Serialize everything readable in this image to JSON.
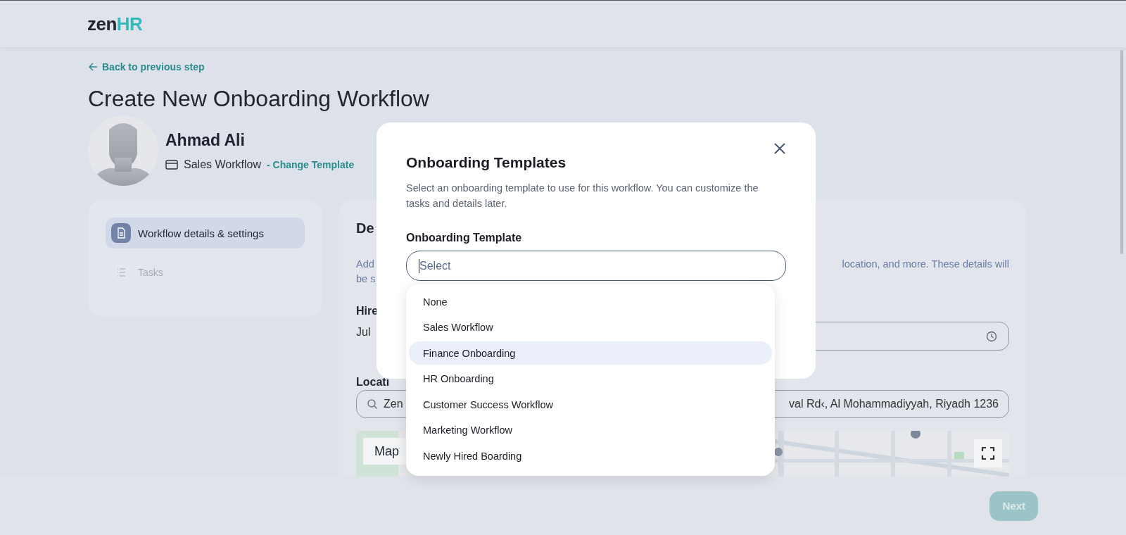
{
  "header": {
    "logo": {
      "part_1": "zen",
      "part_2": "HR"
    }
  },
  "back_link": "Back to previous step",
  "title": "Create New Onboarding Workflow",
  "employee": {
    "name": "Ahmad Ali",
    "template": "Sales Workflow",
    "change_link": "- Change Template"
  },
  "steps": [
    {
      "label": "Workflow details & settings",
      "selected": true
    },
    {
      "label": "Tasks",
      "selected": false
    }
  ],
  "details": {
    "heading": "De",
    "description_start": "Add",
    "description_end": "location, and more. These details will",
    "description_line_2": "be s",
    "hire_label": "Hire",
    "hire_value": "Jul",
    "location_label": "Locati",
    "address_start": "Zen",
    "address_end": "val Rd‹, Al Mohammadiyyah, Riyadh 1236",
    "map_button": "Map"
  },
  "footer": {
    "next_button": {
      "label": "Next",
      "disabled": true
    }
  },
  "modal": {
    "title": "Onboarding Templates",
    "description": "Select an onboarding template to use for this workflow. You can customize the tasks and details later.",
    "field_label": "Onboarding Template",
    "placeholder": "Select",
    "options": [
      {
        "label": "None",
        "selected": false
      },
      {
        "label": "Sales Workflow",
        "selected": false
      },
      {
        "label": "Finance Onboarding",
        "selected": true
      },
      {
        "label": "HR Onboarding",
        "selected": false
      },
      {
        "label": "Customer Success Workflow",
        "selected": false
      },
      {
        "label": "Marketing Workflow",
        "selected": false
      },
      {
        "label": "Newly Hired Boarding",
        "selected": false
      }
    ]
  }
}
